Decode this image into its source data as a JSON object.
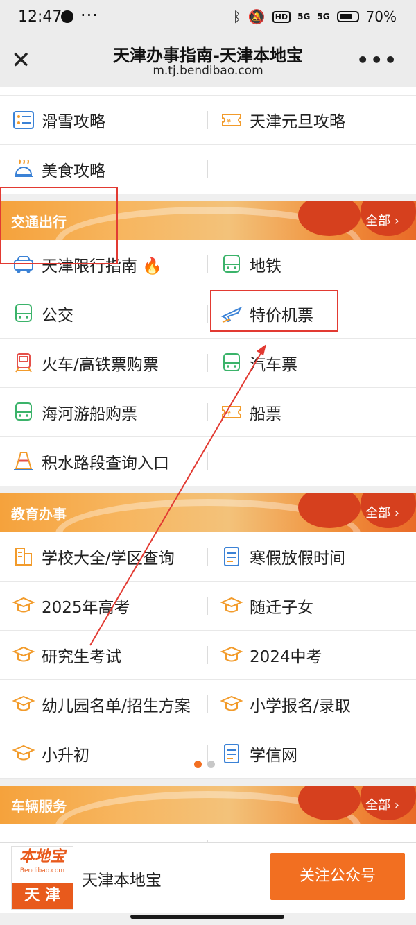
{
  "status": {
    "time": "12:47",
    "battery": "70%",
    "hd": "HD",
    "net": "5G"
  },
  "nav": {
    "title": "天津办事指南-天津本地宝",
    "url": "m.tj.bendibao.com"
  },
  "top_rows": [
    [
      "滑雪攻略",
      "天津元旦攻略"
    ],
    [
      "美食攻略",
      ""
    ]
  ],
  "sections": [
    {
      "title": "交通出行",
      "all": "全部",
      "rows": [
        [
          "天津限行指南 🔥",
          "地铁"
        ],
        [
          "公交",
          "特价机票"
        ],
        [
          "火车/高铁票购票",
          "汽车票"
        ],
        [
          "海河游船购票",
          "船票"
        ],
        [
          "积水路段查询入口",
          ""
        ]
      ]
    },
    {
      "title": "教育办事",
      "all": "全部",
      "rows": [
        [
          "学校大全/学区查询",
          "寒假放假时间"
        ],
        [
          "2025年高考",
          "随迁子女"
        ],
        [
          "研究生考试",
          "2024中考"
        ],
        [
          "幼儿园名单/招生方案",
          "小学报名/录取"
        ],
        [
          "小升初",
          "学信网"
        ]
      ]
    },
    {
      "title": "车辆服务",
      "all": "全部",
      "rows": [
        [
          "交通违章缴费",
          "汽车异地迁入"
        ]
      ]
    }
  ],
  "footer": {
    "logo_top": "本地宝",
    "logo_mid": "Bendibao.com",
    "logo_bottom": "天 津",
    "name": "天津本地宝",
    "follow": "关注公众号"
  },
  "colors": {
    "accent": "#f26f21",
    "highlight": "#e23a32"
  }
}
